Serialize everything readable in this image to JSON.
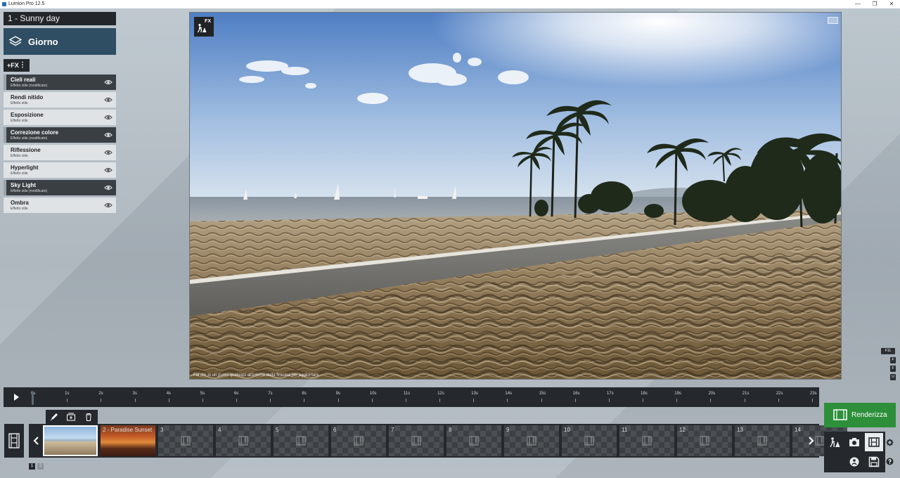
{
  "window": {
    "title": "Lumion Pro 12.5",
    "buttons": [
      "—",
      "❐",
      "✕"
    ]
  },
  "left_panel": {
    "preset_name": "1 - Sunny day",
    "mode": "Giorno",
    "fx_button": "+FX",
    "effects": [
      {
        "name": "Cieli reali",
        "subtitle": "Effetto stile (modificato)",
        "modified": true
      },
      {
        "name": "Rendi nitido",
        "subtitle": "Effetto stile",
        "modified": false
      },
      {
        "name": "Esposizione",
        "subtitle": "Effetto stile",
        "modified": false
      },
      {
        "name": "Correzione colore",
        "subtitle": "Effetto stile (modificato)",
        "modified": true
      },
      {
        "name": "Riflessione",
        "subtitle": "Effetto stile",
        "modified": false
      },
      {
        "name": "Hyperlight",
        "subtitle": "Effetto stile",
        "modified": false
      },
      {
        "name": "Sky Light",
        "subtitle": "Effetto stile (modificato)",
        "modified": true
      },
      {
        "name": "Ombra",
        "subtitle": "Effetto stile",
        "modified": false
      }
    ]
  },
  "viewport": {
    "fx_badge": "FX",
    "hint": "Fai clic in un punto qualsiasi all'interno della finestra per aggiornare"
  },
  "side_keys": [
    "F11",
    "F",
    "F",
    "U"
  ],
  "timeline": {
    "ticks": [
      "0s",
      "1s",
      "2s",
      "3s",
      "4s",
      "5s",
      "6s",
      "7s",
      "8s",
      "9s",
      "10s",
      "11s",
      "12s",
      "13s",
      "14s",
      "15s",
      "16s",
      "17s",
      "18s",
      "19s",
      "20s",
      "21s",
      "22s",
      "23s"
    ]
  },
  "clips": [
    {
      "num": "1",
      "label": "",
      "type": "beach",
      "active": true
    },
    {
      "num": "2",
      "label": "2 - Paradise Sunset",
      "type": "sunset",
      "active": false
    },
    {
      "num": "3",
      "label": "3",
      "type": "empty"
    },
    {
      "num": "4",
      "label": "4",
      "type": "empty"
    },
    {
      "num": "5",
      "label": "5",
      "type": "empty"
    },
    {
      "num": "6",
      "label": "6",
      "type": "empty"
    },
    {
      "num": "7",
      "label": "7",
      "type": "empty"
    },
    {
      "num": "8",
      "label": "8",
      "type": "empty"
    },
    {
      "num": "9",
      "label": "9",
      "type": "empty"
    },
    {
      "num": "10",
      "label": "10",
      "type": "empty"
    },
    {
      "num": "11",
      "label": "11",
      "type": "empty"
    },
    {
      "num": "12",
      "label": "12",
      "type": "empty"
    },
    {
      "num": "13",
      "label": "13",
      "type": "empty"
    },
    {
      "num": "14",
      "label": "14",
      "type": "empty"
    }
  ],
  "pages": [
    "1",
    "2"
  ],
  "render_button": "Renderizza",
  "colors": {
    "accent_green": "#2d8f3a",
    "mode_card": "#2f4e63",
    "dark_panel": "#25292d"
  }
}
